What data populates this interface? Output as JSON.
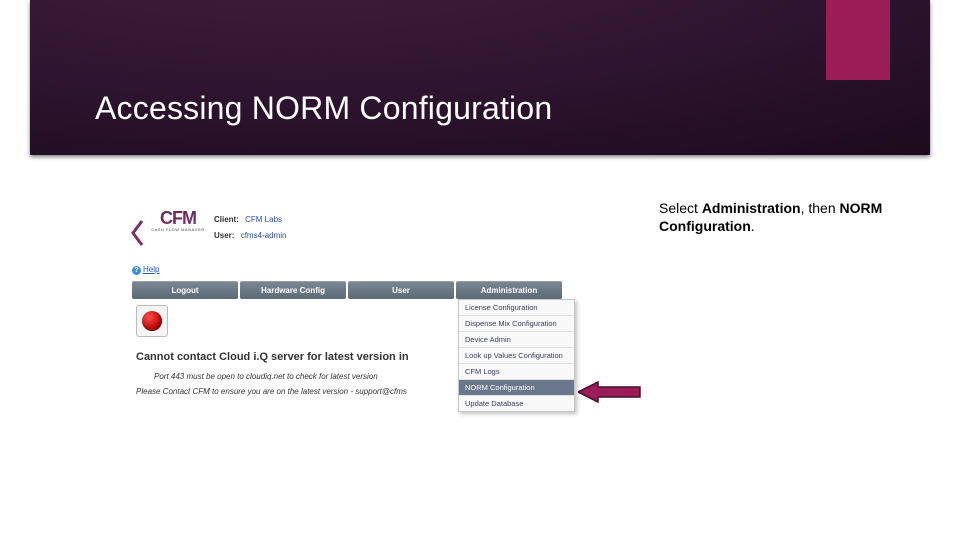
{
  "slide_title": "Accessing NORM Configuration",
  "caption": {
    "pre": "Select ",
    "bold1": "Administration",
    "mid": ", then ",
    "bold2": "NORM Configuration",
    "post": "."
  },
  "app": {
    "logo_text": "CFM",
    "logo_sub": "CASH FLOW MANAGER",
    "client_label": "Client:",
    "client_value": "CFM Labs",
    "user_label": "User:",
    "user_value": "cfms4-admin",
    "help": "Help"
  },
  "nav": {
    "items": [
      {
        "label": "Logout"
      },
      {
        "label": "Hardware Config"
      },
      {
        "label": "User"
      },
      {
        "label": "Administration"
      }
    ]
  },
  "error": {
    "title": "Cannot contact Cloud i.Q server for latest version in",
    "line1": "Port 443 must be open to cloudiq.net to check for latest version",
    "line2": "Please Contact CFM to ensure you are on the latest version - support@cfms"
  },
  "dropdown": {
    "items": [
      {
        "label": "License Configuration"
      },
      {
        "label": "Dispense Mix Configuration"
      },
      {
        "label": "Device Admin"
      },
      {
        "label": "Look up Values Configuration"
      },
      {
        "label": "CFM Logs"
      },
      {
        "label": "NORM Configuration"
      },
      {
        "label": "Update Database"
      }
    ]
  }
}
